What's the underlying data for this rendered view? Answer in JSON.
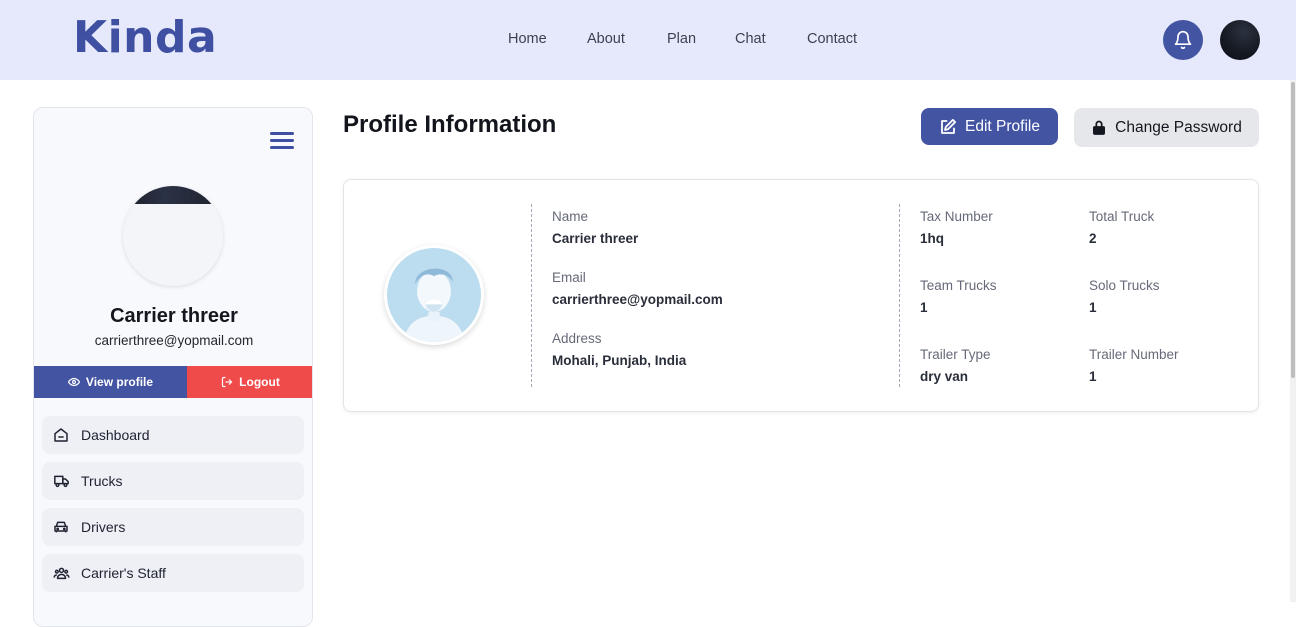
{
  "header": {
    "logo": "Kinda",
    "nav": [
      "Home",
      "About",
      "Plan",
      "Chat",
      "Contact"
    ],
    "icons": {
      "notifications": "bell-icon",
      "user": "user-avatar"
    }
  },
  "sidebar": {
    "user_name": "Carrier threer",
    "user_email": "carrierthree@yopmail.com",
    "view_profile_label": "View profile",
    "logout_label": "Logout",
    "menu": [
      {
        "label": "Dashboard",
        "icon": "home-icon"
      },
      {
        "label": "Trucks",
        "icon": "truck-icon"
      },
      {
        "label": "Drivers",
        "icon": "car-icon"
      },
      {
        "label": "Carrier's Staff",
        "icon": "users-icon"
      }
    ]
  },
  "main": {
    "title": "Profile Information",
    "edit_label": "Edit Profile",
    "change_password_label": "Change Password",
    "profile": {
      "name_label": "Name",
      "name": "Carrier threer",
      "email_label": "Email",
      "email": "carrierthree@yopmail.com",
      "address_label": "Address",
      "address": "Mohali, Punjab, India",
      "tax_label": "Tax Number",
      "tax": "1hq",
      "total_truck_label": "Total Truck",
      "total_truck": "2",
      "team_trucks_label": "Team Trucks",
      "team_trucks": "1",
      "solo_trucks_label": "Solo Trucks",
      "solo_trucks": "1",
      "trailer_type_label": "Trailer Type",
      "trailer_type": "dry van",
      "trailer_number_label": "Trailer Number",
      "trailer_number": "1"
    }
  },
  "colors": {
    "primary": "#4354a3",
    "header_bg": "#e6e9fb",
    "danger": "#f04b4b"
  }
}
